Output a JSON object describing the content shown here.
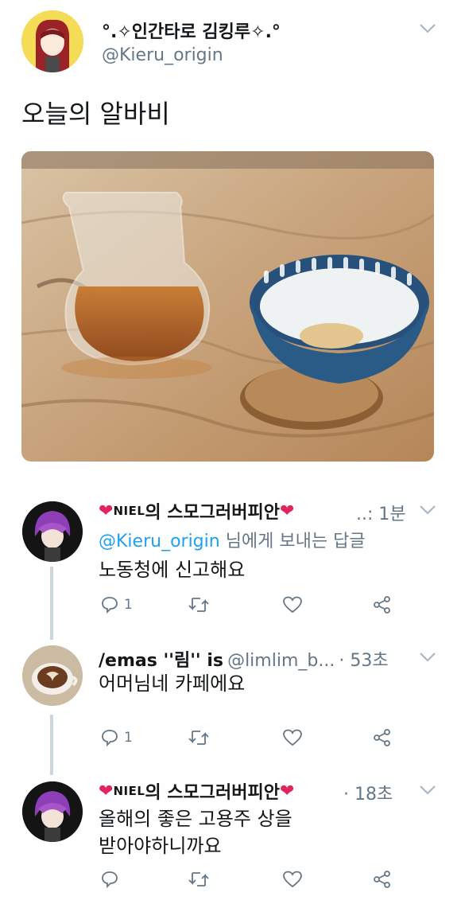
{
  "tweet": {
    "display_name": "°.✧인간타로 김킹루✧.°",
    "handle": "@Kieru_origin",
    "text": "오늘의 알바비"
  },
  "replies": [
    {
      "name_tag": "NIEL",
      "name": "의 스모그러버피안",
      "time_sep": "..: ",
      "time": "1분",
      "reply_to_handle": "@Kieru_origin",
      "reply_to_suffix": " 님에게 보내는 답글",
      "text": "노동청에 신고해요",
      "reply_count": "1"
    },
    {
      "name": "/emas ''림'' is",
      "handle": "@limlim_b...",
      "time_sep": " · ",
      "time": "53초",
      "text": "어머님네 카페에요",
      "reply_count": "1"
    },
    {
      "name_tag": "NIEL",
      "name": "의 스모그러버피안",
      "time_sep": " · ",
      "time": "18초",
      "text_line1": "올해의 좋은 고용주 상을",
      "text_line2": "받아야하니까요"
    }
  ],
  "icons": {
    "reply": "reply-icon",
    "retweet": "retweet-icon",
    "like": "heart-icon",
    "share": "share-icon",
    "more": "chevron-down-icon"
  },
  "colors": {
    "link": "#1da1f2",
    "muted": "#657786",
    "heart_emoji": "#e0245e"
  }
}
